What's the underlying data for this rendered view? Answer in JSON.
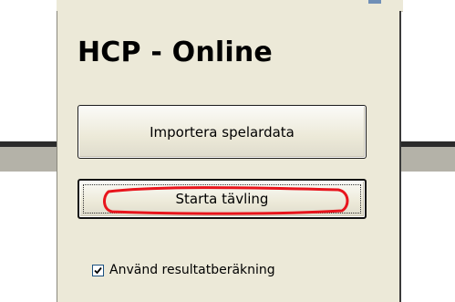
{
  "app": {
    "title": "HCP - Online"
  },
  "buttons": {
    "import_label": "Importera spelardata",
    "start_label": "Starta tävling"
  },
  "options": {
    "use_result_calc": {
      "label": "Använd resultatberäkning",
      "checked": true
    }
  },
  "colors": {
    "panel_bg": "#ece9d8",
    "annotation_red": "#e8141c",
    "checkbox_border": "#1c5180"
  }
}
